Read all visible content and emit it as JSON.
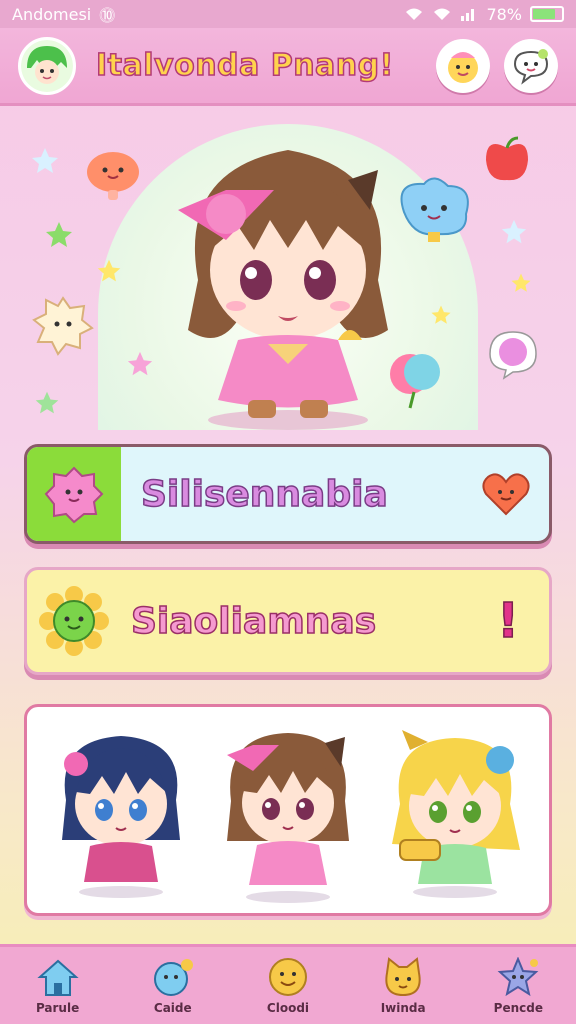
{
  "status_bar": {
    "carrier": "Andomesi",
    "battery": "78%",
    "battery_level": 0.78
  },
  "header": {
    "title": "Italvonda Pnang!"
  },
  "cards": [
    {
      "label": "Silisennabia"
    },
    {
      "label": "Siaoliamnas"
    }
  ],
  "bottom_nav": [
    {
      "label": "Parule",
      "icon": "house-icon"
    },
    {
      "label": "Caide",
      "icon": "blue-pet-icon"
    },
    {
      "label": "Cloodi",
      "icon": "smiley-icon"
    },
    {
      "label": "Iwinda",
      "icon": "cat-face-icon"
    },
    {
      "label": "Pencde",
      "icon": "star-creature-icon"
    }
  ],
  "colors": {
    "accent_pink": "#f1a8d2",
    "title_yellow": "#ffd34d",
    "card1_bg": "#dff6fb",
    "card2_bg": "#fbf2a8"
  }
}
